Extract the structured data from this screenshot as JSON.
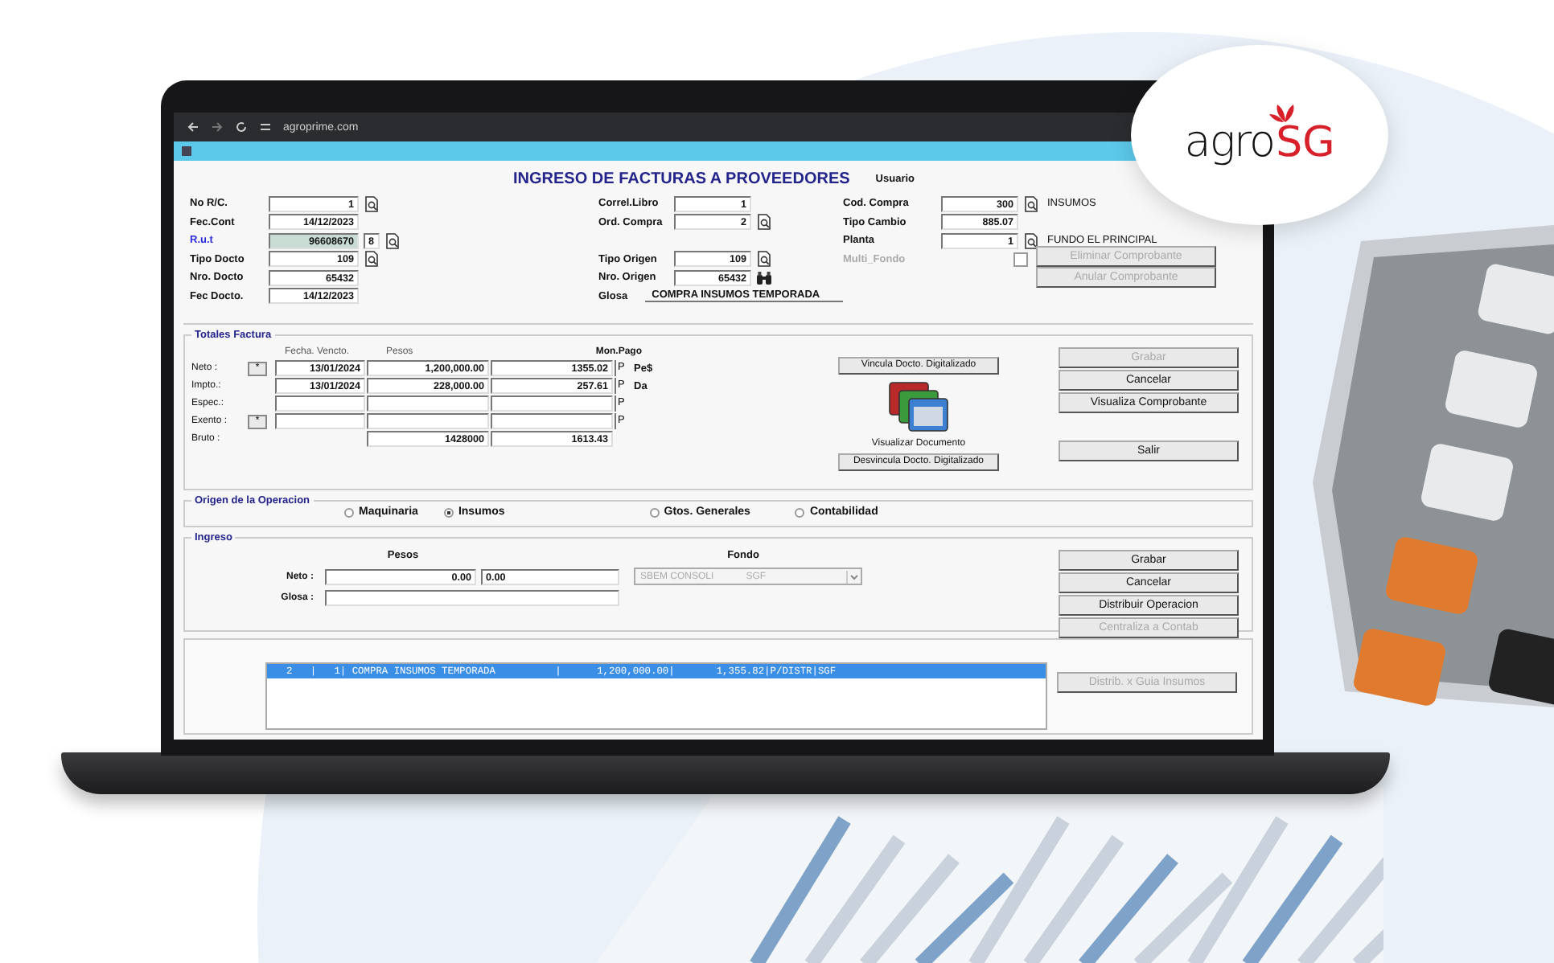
{
  "browser": {
    "url": "agroprime.com"
  },
  "logo": {
    "text": "agro",
    "accent": "SG"
  },
  "form": {
    "title": "INGRESO DE FACTURAS A PROVEEDORES",
    "user_label": "Usuario",
    "header_left": [
      {
        "label": "No R/C.",
        "value": "1",
        "link": false,
        "focused": false,
        "lookup": true
      },
      {
        "label": "Fec.Cont",
        "value": "14/12/2023",
        "link": false,
        "focused": false,
        "lookup": false
      },
      {
        "label": "R.u.t",
        "value": "96608670",
        "extra": "8",
        "link": true,
        "focused": true,
        "lookup": true
      },
      {
        "label": "Tipo Docto",
        "value": "109",
        "link": false,
        "focused": false,
        "lookup": true
      },
      {
        "label": "Nro. Docto",
        "value": "65432",
        "link": false,
        "focused": false,
        "lookup": false
      },
      {
        "label": "Fec Docto.",
        "value": "14/12/2023",
        "link": false,
        "focused": false,
        "lookup": false
      }
    ],
    "header_mid": [
      {
        "kind": "field",
        "label": "Correl.Libro",
        "value": "1",
        "lookup": false,
        "binoculars": false
      },
      {
        "kind": "field",
        "label": "Ord. Compra",
        "value": "2",
        "lookup": true,
        "binoculars": false
      },
      {
        "kind": "blank"
      },
      {
        "kind": "field",
        "label": "Tipo Origen",
        "value": "109",
        "lookup": true,
        "binoculars": false
      },
      {
        "kind": "field",
        "label": "Nro. Origen",
        "value": "65432",
        "lookup": false,
        "binoculars": true
      },
      {
        "kind": "text",
        "label": "Glosa",
        "value": "COMPRA INSUMOS TEMPORADA"
      }
    ],
    "header_right": [
      {
        "kind": "field",
        "label": "Cod. Compra",
        "value": "300",
        "lookup": true,
        "note": "INSUMOS"
      },
      {
        "kind": "field",
        "label": "Tipo Cambio",
        "value": "885.07",
        "lookup": false
      },
      {
        "kind": "field",
        "label": "Planta",
        "value": "1",
        "lookup": true,
        "note": "FUNDO EL PRINCIPAL"
      },
      {
        "kind": "checkbox",
        "label": "Multi_Fondo",
        "checked": false,
        "disabled": true
      }
    ],
    "header_buttons": [
      {
        "label": "Eliminar Comprobante",
        "disabled": true
      },
      {
        "label": "Anular Comprobante",
        "disabled": true
      }
    ],
    "totals": {
      "title": "Totales Factura",
      "columns": [
        "Fecha. Vencto.",
        "Pesos",
        "Mon.Pago"
      ],
      "rows": [
        {
          "label": "Neto :",
          "star_button": "*",
          "date": "13/01/2024",
          "pesos": "1,200,000.00",
          "amount": "1355.02",
          "currency": "P",
          "note": "Pe$"
        },
        {
          "label": "Impto.:",
          "date": "13/01/2024",
          "pesos": "228,000.00",
          "amount": "257.61",
          "currency": "P",
          "note": "Da"
        },
        {
          "label": "Espec.:",
          "currency": "P"
        },
        {
          "label": "Exento :",
          "star_button": "*",
          "currency": "P"
        }
      ],
      "bruto": {
        "label": "Bruto :",
        "pesos": "1428000",
        "amount": "1613.43"
      }
    },
    "documents": {
      "link_button": "Vincula Docto. Digitalizado",
      "caption": "Visualizar Documento",
      "unlink_button": "Desvincula Docto. Digitalizado"
    },
    "actions": [
      {
        "label": "Grabar",
        "disabled": true
      },
      {
        "label": "Cancelar",
        "disabled": false
      },
      {
        "label": "Visualiza Comprobante",
        "disabled": false
      }
    ],
    "exit_button": {
      "label": "Salir",
      "disabled": false
    },
    "origin": {
      "title": "Origen de la Operacion",
      "options": [
        {
          "label": "Maquinaria",
          "selected": false
        },
        {
          "label": "Insumos",
          "selected": true
        },
        {
          "label": "Gtos. Generales",
          "selected": false
        },
        {
          "label": "Contabilidad",
          "selected": false
        }
      ]
    },
    "entry": {
      "title": "Ingreso",
      "pesos_label": "Pesos",
      "fondo_label": "Fondo",
      "neto_label": "Neto :",
      "neto_pesos": "0.00",
      "neto_other": "0.00",
      "glosa_label": "Glosa :",
      "fondo_select": {
        "value": "SBEM CONSOLI",
        "code": "SGF",
        "disabled": true
      },
      "buttons": [
        {
          "label": "Grabar",
          "disabled": false
        },
        {
          "label": "Cancelar",
          "disabled": false
        },
        {
          "label": "Distribuir Operacion",
          "disabled": false
        },
        {
          "label": "Centraliza a Contab",
          "disabled": true
        }
      ]
    },
    "list": {
      "rows": [
        {
          "text": "2   |   1| COMPRA INSUMOS TEMPORADA          |      1,200,000.00|       1,355.82|P/DISTR|SGF",
          "selected": true
        }
      ],
      "button": {
        "label": "Distrib. x Guia Insumos",
        "disabled": true
      }
    }
  }
}
